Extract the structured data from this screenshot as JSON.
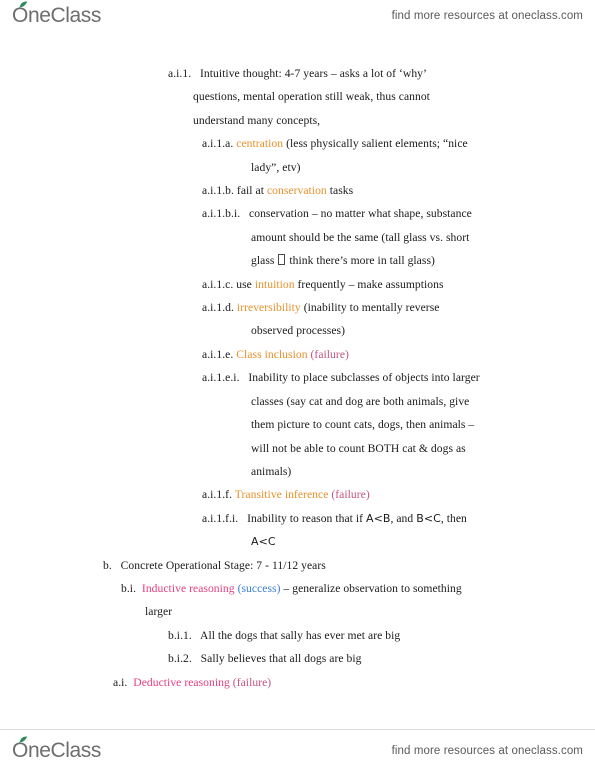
{
  "branding": {
    "logo_text_prefix": "O",
    "logo_text_rest": "neClass",
    "leaf_color": "#2e8b57",
    "tagline": "find more resources at oneclass.com"
  },
  "colors": {
    "orange": "#e8912b",
    "pink": "#e8407f",
    "rose": "#c4537f",
    "blue": "#3a7fd5",
    "body_text": "#1a1a1a"
  },
  "document": {
    "lines": [
      {
        "id": "ai1-intuitive-thought",
        "label": "a.i.1.",
        "indent": "ind-ai1",
        "text": "   Intuitive thought: 4-7 years – asks a lot of ‘why’"
      },
      {
        "id": "ai1-wrap-1",
        "indent": "ind-ai1w",
        "text": "questions, mental operation still weak, thus cannot"
      },
      {
        "id": "ai1-wrap-2",
        "indent": "ind-ai1w",
        "text": "understand many concepts,"
      },
      {
        "id": "ai1a-centration",
        "label": "a.i.1.a.",
        "indent": "ind-l3",
        "keyword": " centration",
        "text": " (less physically salient elements; “nice"
      },
      {
        "id": "ai1a-wrap",
        "indent": "ind-l3w",
        "text": "lady”, etv)"
      },
      {
        "id": "ai1b-conservation",
        "label": "a.i.1.b.",
        "indent": "ind-l3",
        "pre": " fail at ",
        "keyword": "conservation",
        "text": " tasks"
      },
      {
        "id": "ai1bi-conservation",
        "label": "a.i.1.b.i.",
        "indent": "ind-l4",
        "text": "   conservation – no matter what shape, substance"
      },
      {
        "id": "ai1bi-wrap-1",
        "indent": "ind-l4w",
        "text": "amount should be the same (tall glass vs. short"
      },
      {
        "id": "ai1bi-wrap-2",
        "indent": "ind-l4w",
        "text_before_tofu": "glass ",
        "text_after_tofu": " think there’s more in tall glass)"
      },
      {
        "id": "ai1c-intuition",
        "label": "a.i.1.c.",
        "indent": "ind-l3",
        "pre": " use ",
        "keyword": "intuition",
        "text": " frequently – make assumptions"
      },
      {
        "id": "ai1d-irreversibility",
        "label": "a.i.1.d.",
        "indent": "ind-l3",
        "keyword": " irreversibility",
        "text": " (inability to mentally reverse"
      },
      {
        "id": "ai1d-wrap",
        "indent": "ind-l3w",
        "text": "observed processes)"
      },
      {
        "id": "ai1e-class-inclusion",
        "label": "a.i.1.e.",
        "indent": "ind-l3",
        "keyword": " Class inclusion",
        "tail_rose": " (failure)"
      },
      {
        "id": "ai1ei-inability",
        "label": "a.i.1.e.i.",
        "indent": "ind-l4",
        "text": "   Inability to place subclasses of objects into larger"
      },
      {
        "id": "ai1ei-wrap-1",
        "indent": "ind-l4w",
        "text": "classes (say cat and dog are both animals, give"
      },
      {
        "id": "ai1ei-wrap-2",
        "indent": "ind-l4w",
        "text": "them picture to count cats, dogs, then animals –"
      },
      {
        "id": "ai1ei-wrap-3",
        "indent": "ind-l4w",
        "text": "will not be able to count BOTH cat & dogs as"
      },
      {
        "id": "ai1ei-wrap-4",
        "indent": "ind-l4w",
        "text": "animals)"
      },
      {
        "id": "ai1f-transitive-inference",
        "label": "a.i.1.f.",
        "indent": "ind-l3",
        "keyword": " Transitive inference",
        "tail_rose": " (failure)"
      },
      {
        "id": "ai1fi-inability-reason",
        "label": "a.i.1.f.i.",
        "indent": "ind-l4",
        "text_plain_1": "   Inability to reason that if ",
        "ineq_1": "A<B",
        "text_plain_2": ", and ",
        "ineq_2": "B<C",
        "text_plain_3": ", then"
      },
      {
        "id": "ai1fi-wrap",
        "indent": "ind-l4w",
        "ineq_1": "A<C"
      },
      {
        "id": "b-concrete-operational",
        "label": "b.",
        "indent": "ind-b",
        "text": "   Concrete Operational Stage: 7 - 11/12 years"
      },
      {
        "id": "bi-inductive-reasoning",
        "label": "b.i.",
        "indent": "ind-bi",
        "keyword_pink": "  Inductive reasoning",
        "keyword_blue": " (success)",
        "text": " – generalize observation to something"
      },
      {
        "id": "bi-wrap",
        "indent": "ind-bi2",
        "text": "larger"
      },
      {
        "id": "bi1-all-dogs",
        "label": "b.i.1.",
        "indent": "ind-bi1",
        "text": "   All the dogs that sally has ever met are big"
      },
      {
        "id": "bi2-sally-believes",
        "label": "b.i.2.",
        "indent": "ind-bi1",
        "text": "   Sally believes that all dogs are big"
      },
      {
        "id": "ai-deductive-reasoning",
        "label": "a.i.",
        "indent": "ind-ai",
        "keyword_pink": "  Deductive reasoning",
        "tail_rose": " (failure)"
      }
    ]
  }
}
